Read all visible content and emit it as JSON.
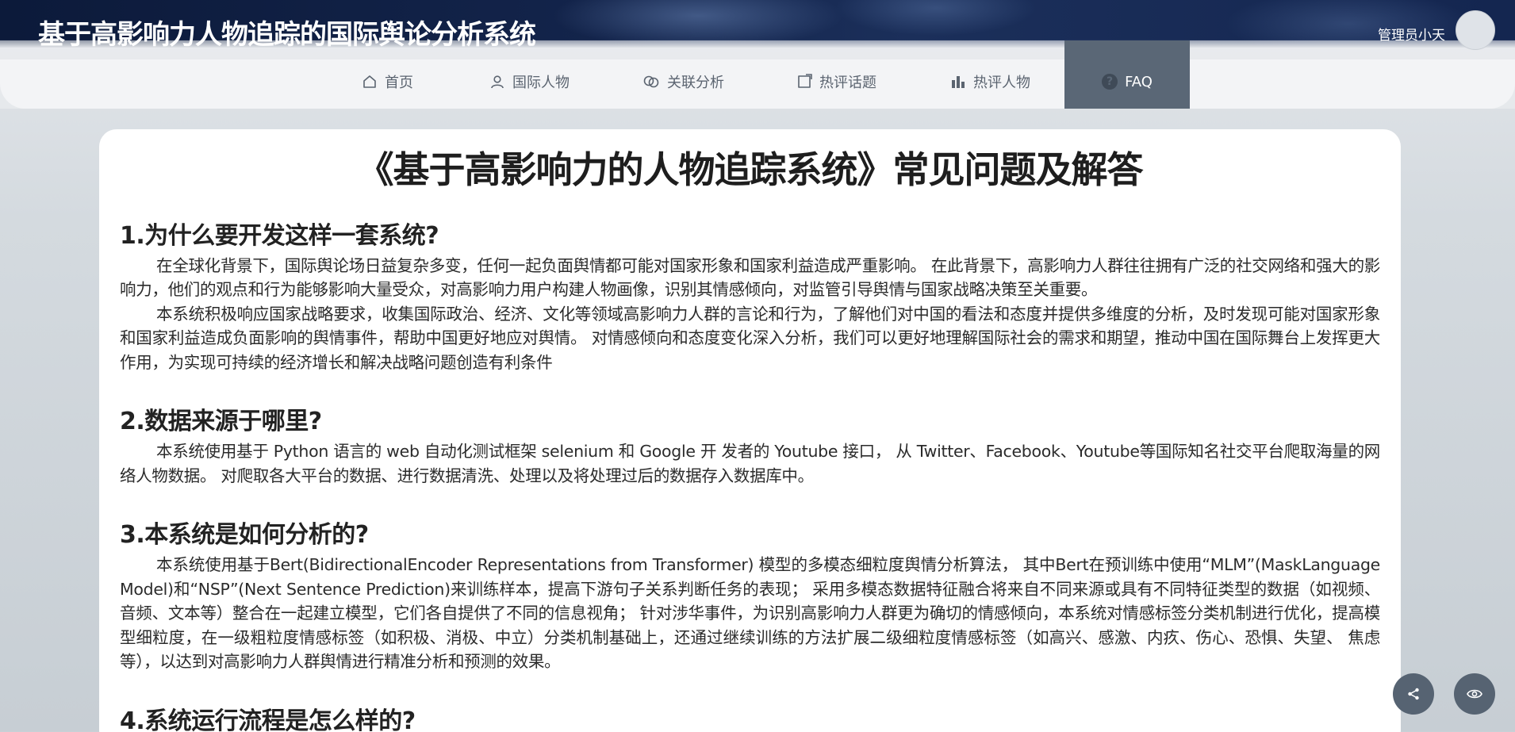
{
  "header": {
    "app_title": "基于高影响力人物追踪的国际舆论分析系统",
    "user_name": "管理员小天"
  },
  "nav": {
    "items": [
      {
        "label": "首页",
        "icon": "home-icon"
      },
      {
        "label": "国际人物",
        "icon": "user-icon"
      },
      {
        "label": "关联分析",
        "icon": "link-icon"
      },
      {
        "label": "热评话题",
        "icon": "comment-icon"
      },
      {
        "label": "热评人物",
        "icon": "bar-chart-icon"
      },
      {
        "label": "FAQ",
        "icon": "question-icon",
        "active": true
      }
    ]
  },
  "content": {
    "title": "《基于高影响力的人物追踪系统》常见问题及解答",
    "sections": [
      {
        "question": "1.为什么要开发这样一套系统?",
        "paragraphs": [
          "在全球化背景下，国际舆论场日益复杂多变，任何一起负面舆情都可能对国家形象和国家利益造成严重影响。 在此背景下，高影响力人群往往拥有广泛的社交网络和强大的影响力，他们的观点和行为能够影响大量受众，对高影响力用户构建人物画像，识别其情感倾向，对监管引导舆情与国家战略决策至关重要。",
          "本系统积极响应国家战略要求，收集国际政治、经济、文化等领域高影响力人群的言论和行为，了解他们对中国的看法和态度并提供多维度的分析，及时发现可能对国家形象和国家利益造成负面影响的舆情事件，帮助中国更好地应对舆情。 对情感倾向和态度变化深入分析，我们可以更好地理解国际社会的需求和期望，推动中国在国际舞台上发挥更大作用，为实现可持续的经济增长和解决战略问题创造有利条件"
        ]
      },
      {
        "question": "2.数据来源于哪里?",
        "paragraphs": [
          "本系统使用基于 Python 语言的 web 自动化测试框架 selenium 和 Google 开 发者的 Youtube 接口， 从 Twitter、Facebook、Youtube等国际知名社交平台爬取海量的网络人物数据。 对爬取各大平台的数据、进行数据清洗、处理以及将处理过后的数据存入数据库中。"
        ]
      },
      {
        "question": "3.本系统是如何分析的?",
        "paragraphs": [
          "本系统使用基于Bert(BidirectionalEncoder Representations from Transformer) 模型的多模态细粒度舆情分析算法， 其中Bert在预训练中使用“MLM”(MaskLanguage Model)和“NSP”(Next Sentence Prediction)来训练样本，提高下游句子关系判断任务的表现； 采用多模态数据特征融合将来自不同来源或具有不同特征类型的数据（如视频、音频、文本等）整合在一起建立模型，它们各自提供了不同的信息视角； 针对涉华事件，为识别高影响力人群更为确切的情感倾向，本系统对情感标签分类机制进行优化，提高模型细粒度，在一级粗粒度情感标签（如积极、消极、中立）分类机制基础上，还通过继续训练的方法扩展二级细粒度情感标签（如高兴、感激、内疚、伤心、恐惧、失望、 焦虑等），以达到对高影响力人群舆情进行精准分析和预测的效果。"
        ]
      },
      {
        "question": "4.系统运行流程是怎么样的?",
        "paragraphs": []
      }
    ]
  },
  "floating_buttons": [
    {
      "icon": "share-icon"
    },
    {
      "icon": "eye-icon"
    }
  ],
  "colors": {
    "nav_active_bg": "#5a6776",
    "fab_bg": "#566372",
    "banner_bg": "#13244b"
  }
}
